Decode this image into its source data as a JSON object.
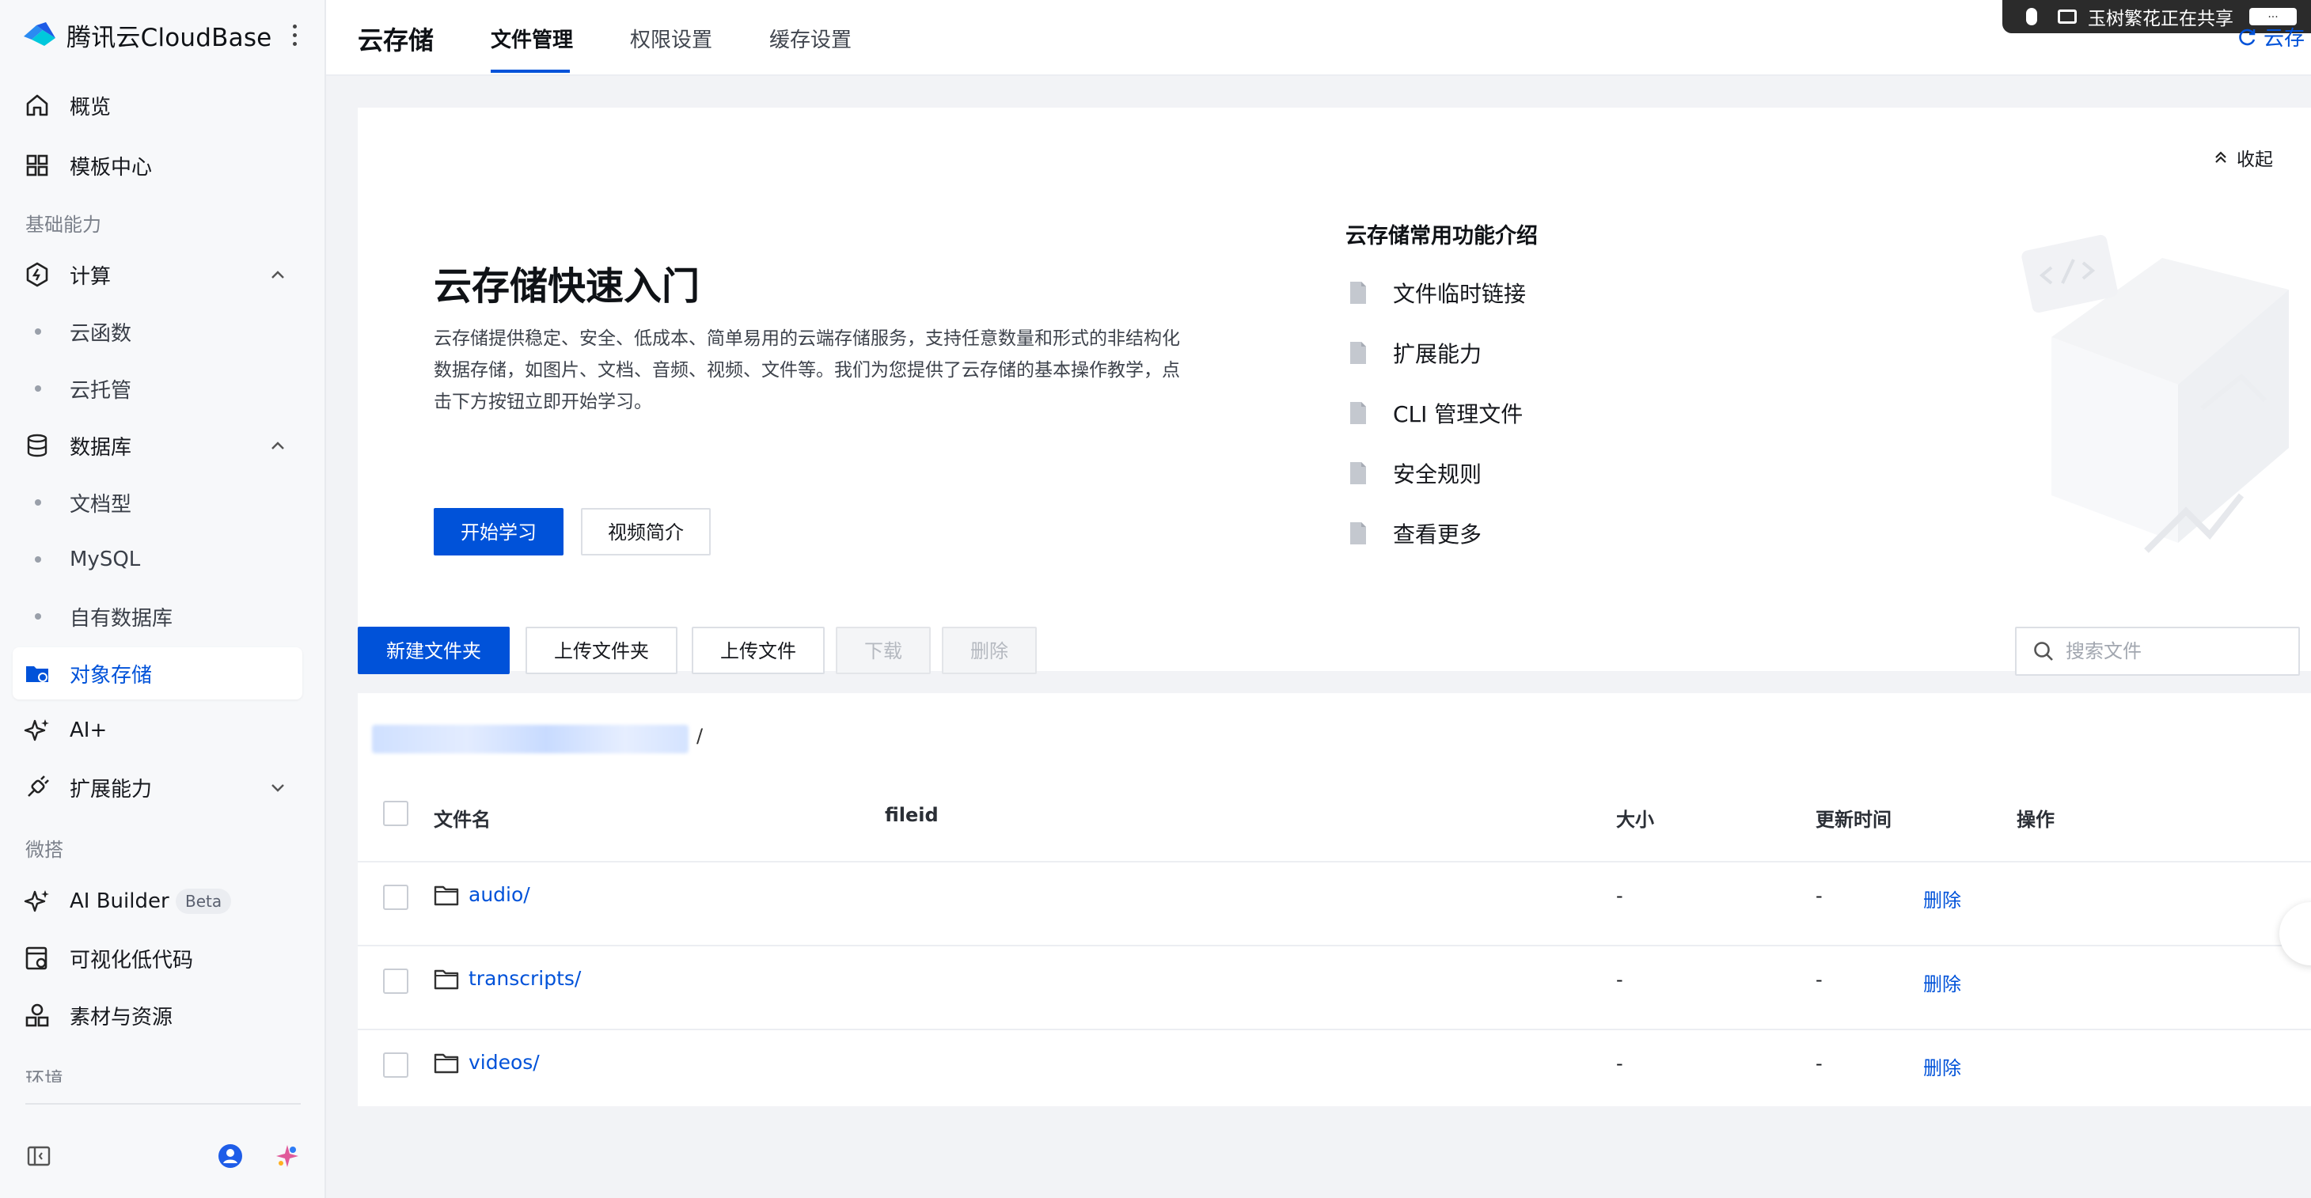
{
  "brand": {
    "name": "腾讯云CloudBase"
  },
  "sidebar": {
    "top_items": [
      {
        "label": "概览",
        "icon": "home-icon"
      },
      {
        "label": "模板中心",
        "icon": "grid-icon"
      }
    ],
    "section_basic": "基础能力",
    "compute": {
      "label": "计算",
      "children": [
        "云函数",
        "云托管"
      ]
    },
    "database": {
      "label": "数据库",
      "children": [
        "文档型",
        "MySQL",
        "自有数据库"
      ]
    },
    "storage": {
      "label": "对象存储"
    },
    "ai": {
      "label": "AI+"
    },
    "extensions": {
      "label": "扩展能力"
    },
    "section_micro": "微搭",
    "ai_builder": {
      "label": "AI Builder",
      "badge": "Beta"
    },
    "lowcode": {
      "label": "可视化低代码"
    },
    "assets": {
      "label": "素材与资源"
    },
    "section_env": "环境"
  },
  "header": {
    "title": "云存储",
    "tabs": [
      "文件管理",
      "权限设置",
      "缓存设置"
    ],
    "active_tab": "文件管理",
    "screen_share": "玉树繁花正在共享",
    "screen_share_stop": "...",
    "right_link": "云存"
  },
  "intro": {
    "collapse": "收起",
    "title": "云存储快速入门",
    "description": "云存储提供稳定、安全、低成本、简单易用的云端存储服务，支持任意数量和形式的非结构化数据存储，如图片、文档、音频、视频、文件等。我们为您提供了云存储的基本操作教学，点击下方按钮立即开始学习。",
    "start_button": "开始学习",
    "video_button": "视频简介",
    "features_title": "云存储常用功能介绍",
    "features": [
      "文件临时链接",
      "扩展能力",
      "CLI 管理文件",
      "安全规则",
      "查看更多"
    ]
  },
  "toolbar": {
    "new_folder": "新建文件夹",
    "upload_folder": "上传文件夹",
    "upload_file": "上传文件",
    "download": "下载",
    "delete": "删除",
    "search_placeholder": "搜索文件"
  },
  "files": {
    "path_separator": "/",
    "columns": [
      "文件名",
      "fileid",
      "大小",
      "更新时间",
      "操作"
    ],
    "rows": [
      {
        "name": "audio/",
        "fileid": "",
        "size": "-",
        "updated": "-",
        "action": "删除"
      },
      {
        "name": "transcripts/",
        "fileid": "",
        "size": "-",
        "updated": "-",
        "action": "删除"
      },
      {
        "name": "videos/",
        "fileid": "",
        "size": "-",
        "updated": "-",
        "action": "删除"
      }
    ]
  },
  "colors": {
    "primary": "#0052d9",
    "sidebar_bg": "#f7f8fa",
    "main_bg": "#f2f3f6"
  }
}
